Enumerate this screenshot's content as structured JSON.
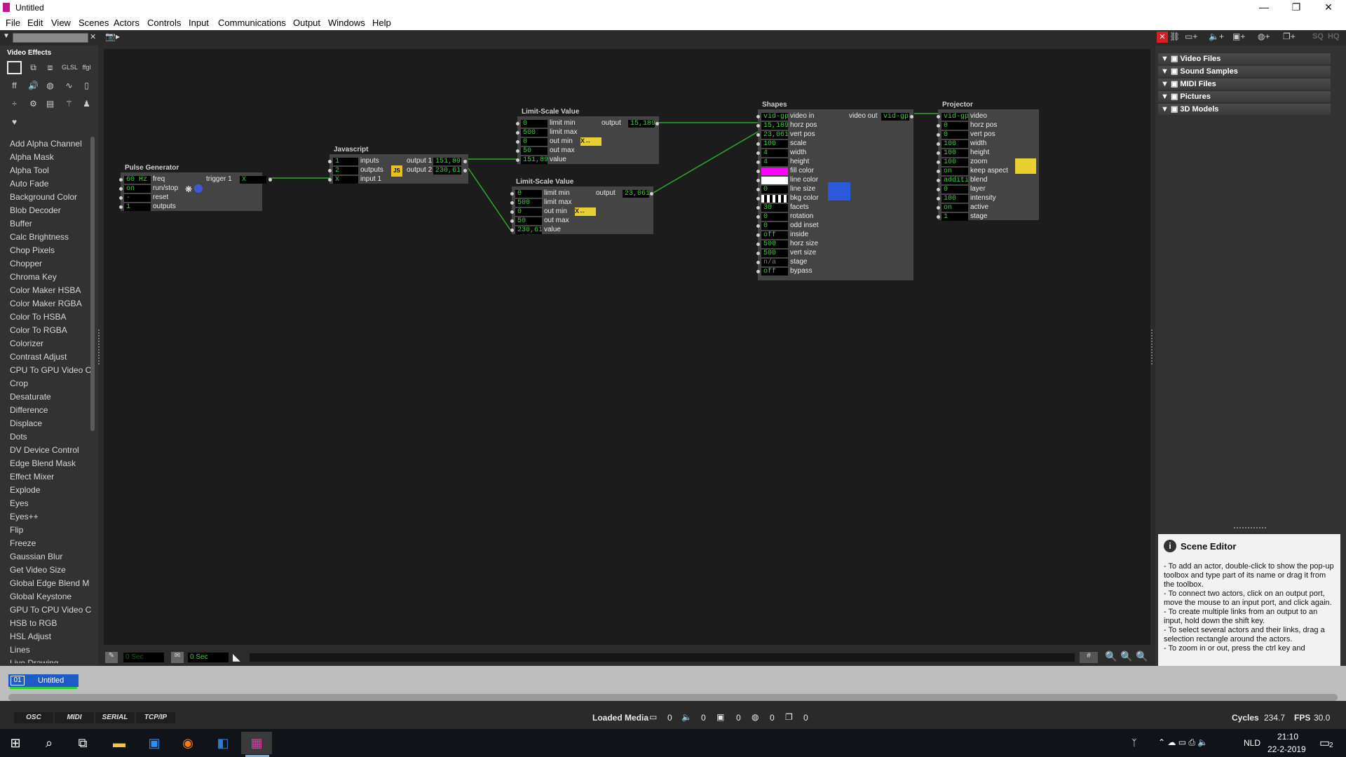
{
  "window": {
    "title": "Untitled"
  },
  "menu": [
    "File",
    "Edit",
    "View",
    "Scenes",
    "Actors",
    "Controls",
    "Input",
    "Communications",
    "Output",
    "Windows",
    "Help"
  ],
  "toolbox": {
    "header": "Video Effects",
    "effects": [
      "Add Alpha Channel",
      "Alpha Mask",
      "Alpha Tool",
      "Auto Fade",
      "Background Color",
      "Blob Decoder",
      "Buffer",
      "Calc Brightness",
      "Chop Pixels",
      "Chopper",
      "Chroma Key",
      "Color Maker HSBA",
      "Color Maker RGBA",
      "Color To HSBA",
      "Color To RGBA",
      "Colorizer",
      "Contrast Adjust",
      "CPU To GPU Video C",
      "Crop",
      "Desaturate",
      "Difference",
      "Displace",
      "Dots",
      "DV Device Control",
      "Edge Blend Mask",
      "Effect Mixer",
      "Explode",
      "Eyes",
      "Eyes++",
      "Flip",
      "Freeze",
      "Gaussian Blur",
      "Get Video Size",
      "Global Edge Blend M",
      "Global Keystone",
      "GPU To CPU Video C",
      "HSB to RGB",
      "HSL Adjust",
      "Lines",
      "Live Drawing"
    ]
  },
  "actors": {
    "pulse": {
      "title": "Pulse Generator",
      "inputs": [
        [
          "60 Hz",
          "freq"
        ],
        [
          "on",
          "run/stop"
        ],
        [
          "-",
          "reset"
        ],
        [
          "1",
          "outputs"
        ]
      ],
      "output_label": "trigger 1",
      "output_value": "X"
    },
    "javascript": {
      "title": "Javascript",
      "inputs": [
        [
          "1",
          "inputs"
        ],
        [
          "2",
          "outputs"
        ],
        [
          "X",
          "input 1"
        ]
      ],
      "outputs": [
        [
          "output 1",
          "151,89"
        ],
        [
          "output 2",
          "230,61"
        ]
      ]
    },
    "lsv1": {
      "title": "Limit-Scale Value",
      "inputs": [
        [
          "0",
          "limit min"
        ],
        [
          "500",
          "limit max"
        ],
        [
          "0",
          "out min"
        ],
        [
          "50",
          "out max"
        ],
        [
          "151,89",
          "value"
        ]
      ],
      "output_label": "output",
      "output_value": "15,189"
    },
    "lsv2": {
      "title": "Limit-Scale Value",
      "inputs": [
        [
          "0",
          "limit min"
        ],
        [
          "500",
          "limit max"
        ],
        [
          "0",
          "out min"
        ],
        [
          "50",
          "out max"
        ],
        [
          "230,61",
          "value"
        ]
      ],
      "output_label": "output",
      "output_value": "23,061"
    },
    "shapes": {
      "title": "Shapes",
      "inputs": [
        [
          "vid-gpu",
          "video in"
        ],
        [
          "15,189",
          "horz pos"
        ],
        [
          "23,061",
          "vert pos"
        ],
        [
          "100",
          "scale"
        ],
        [
          "4",
          "width"
        ],
        [
          "4",
          "height"
        ],
        [
          "",
          "fill color"
        ],
        [
          "",
          "line color"
        ],
        [
          "0",
          "line size"
        ],
        [
          "",
          "bkg color"
        ],
        [
          "30",
          "facets"
        ],
        [
          "0",
          "rotation"
        ],
        [
          "0",
          "odd inset"
        ],
        [
          "off",
          "inside"
        ],
        [
          "500",
          "horz size"
        ],
        [
          "500",
          "vert size"
        ],
        [
          "n/a",
          "stage"
        ],
        [
          "off",
          "bypass"
        ]
      ],
      "output_label": "video out",
      "output_value": "vid-gpu"
    },
    "projector": {
      "title": "Projector",
      "inputs": [
        [
          "vid-gpu",
          "video"
        ],
        [
          "0",
          "horz pos"
        ],
        [
          "0",
          "vert pos"
        ],
        [
          "100",
          "width"
        ],
        [
          "100",
          "height"
        ],
        [
          "100",
          "zoom"
        ],
        [
          "on",
          "keep aspect"
        ],
        [
          "additive",
          "blend"
        ],
        [
          "0",
          "layer"
        ],
        [
          "100",
          "intensity"
        ],
        [
          "on",
          "active"
        ],
        [
          "1",
          "stage"
        ]
      ]
    }
  },
  "media": [
    "Video Files",
    "Sound Samples",
    "MIDI Files",
    "Pictures",
    "3D Models"
  ],
  "scene_editor": {
    "title": "Scene Editor",
    "lines": [
      "- To add an actor, double-click to show the pop-up toolbox and type part of its name or drag it from the toolbox.",
      "- To connect two actors, click on an output port, move the mouse to an input port, and click again.",
      "- To create multiple links from an output to an input, hold down the shift key.",
      "- To select several actors and their links, drag a selection rectangle around the actors.",
      "- To zoom in or out, press the ctrl key and"
    ]
  },
  "timeline": {
    "time1": "0 Sec",
    "time2": "0 Sec",
    "grid": "#"
  },
  "scene_tab": {
    "number": "01",
    "name": "Untitled"
  },
  "status": {
    "protocols": [
      "OSC",
      "MIDI",
      "SERIAL",
      "TCP/IP"
    ],
    "loaded_media_label": "Loaded Media",
    "media_counts": [
      "0",
      "0",
      "0",
      "0",
      "0"
    ],
    "cycles_label": "Cycles",
    "cycles": "234.7",
    "fps_label": "FPS",
    "fps": "30.0"
  },
  "taskbar": {
    "lang": "NLD",
    "time": "21:10",
    "date": "22-2-2019",
    "notifications": "2"
  },
  "colors": {
    "accent_green": "#3fcf3f",
    "fill_color": "#ff00ff",
    "scene_tab": "#1e5bc6"
  }
}
